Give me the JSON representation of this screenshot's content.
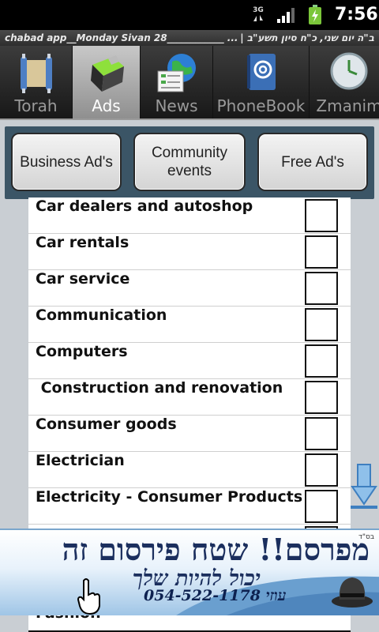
{
  "status_bar": {
    "network": "3G",
    "time": "7:56",
    "icons": [
      "network-3g-icon",
      "signal-icon",
      "battery-charging-icon"
    ]
  },
  "marquee": {
    "left_text": "chabad app__Monday Sivan 28____________ ...",
    "right_text": "ב\"ה יום שני, כ\"ח סיון תשע\"ב |"
  },
  "tabs": [
    {
      "label": "Torah",
      "icon": "torah-scroll-icon",
      "selected": false
    },
    {
      "label": "Ads",
      "icon": "ads-cube-icon",
      "selected": true
    },
    {
      "label": "News",
      "icon": "globe-news-icon",
      "selected": false
    },
    {
      "label": "PhoneBook",
      "icon": "address-book-icon",
      "selected": false
    },
    {
      "label": "Zmanim",
      "icon": "clock-icon",
      "selected": false
    }
  ],
  "category_buttons": [
    {
      "label": "Business Ad's"
    },
    {
      "label": "Community events"
    },
    {
      "label": "Free Ad's"
    }
  ],
  "list": {
    "rows": [
      {
        "label": "Car dealers and autoshop",
        "checked": false
      },
      {
        "label": "Car rentals",
        "checked": false
      },
      {
        "label": "Car service",
        "checked": false
      },
      {
        "label": "Communication",
        "checked": false
      },
      {
        "label": "Computers",
        "checked": false
      },
      {
        "label": " Construction and renovation",
        "checked": false
      },
      {
        "label": "Consumer goods",
        "checked": false
      },
      {
        "label": "Electrician",
        "checked": false
      },
      {
        "label": "Electricity - Consumer Products",
        "checked": false
      }
    ],
    "partial_row_label": "Fashion"
  },
  "ad": {
    "bsd": "בס\"ד",
    "line1": "מפרסם!! שטח פירסום זה",
    "line2": "יכול להיות שלך",
    "phone": "054-522-1178 עוזי"
  },
  "colors": {
    "button_bar": "#3b5566",
    "content_bg": "#c9ced3",
    "ad_text": "#1b2f5e"
  }
}
